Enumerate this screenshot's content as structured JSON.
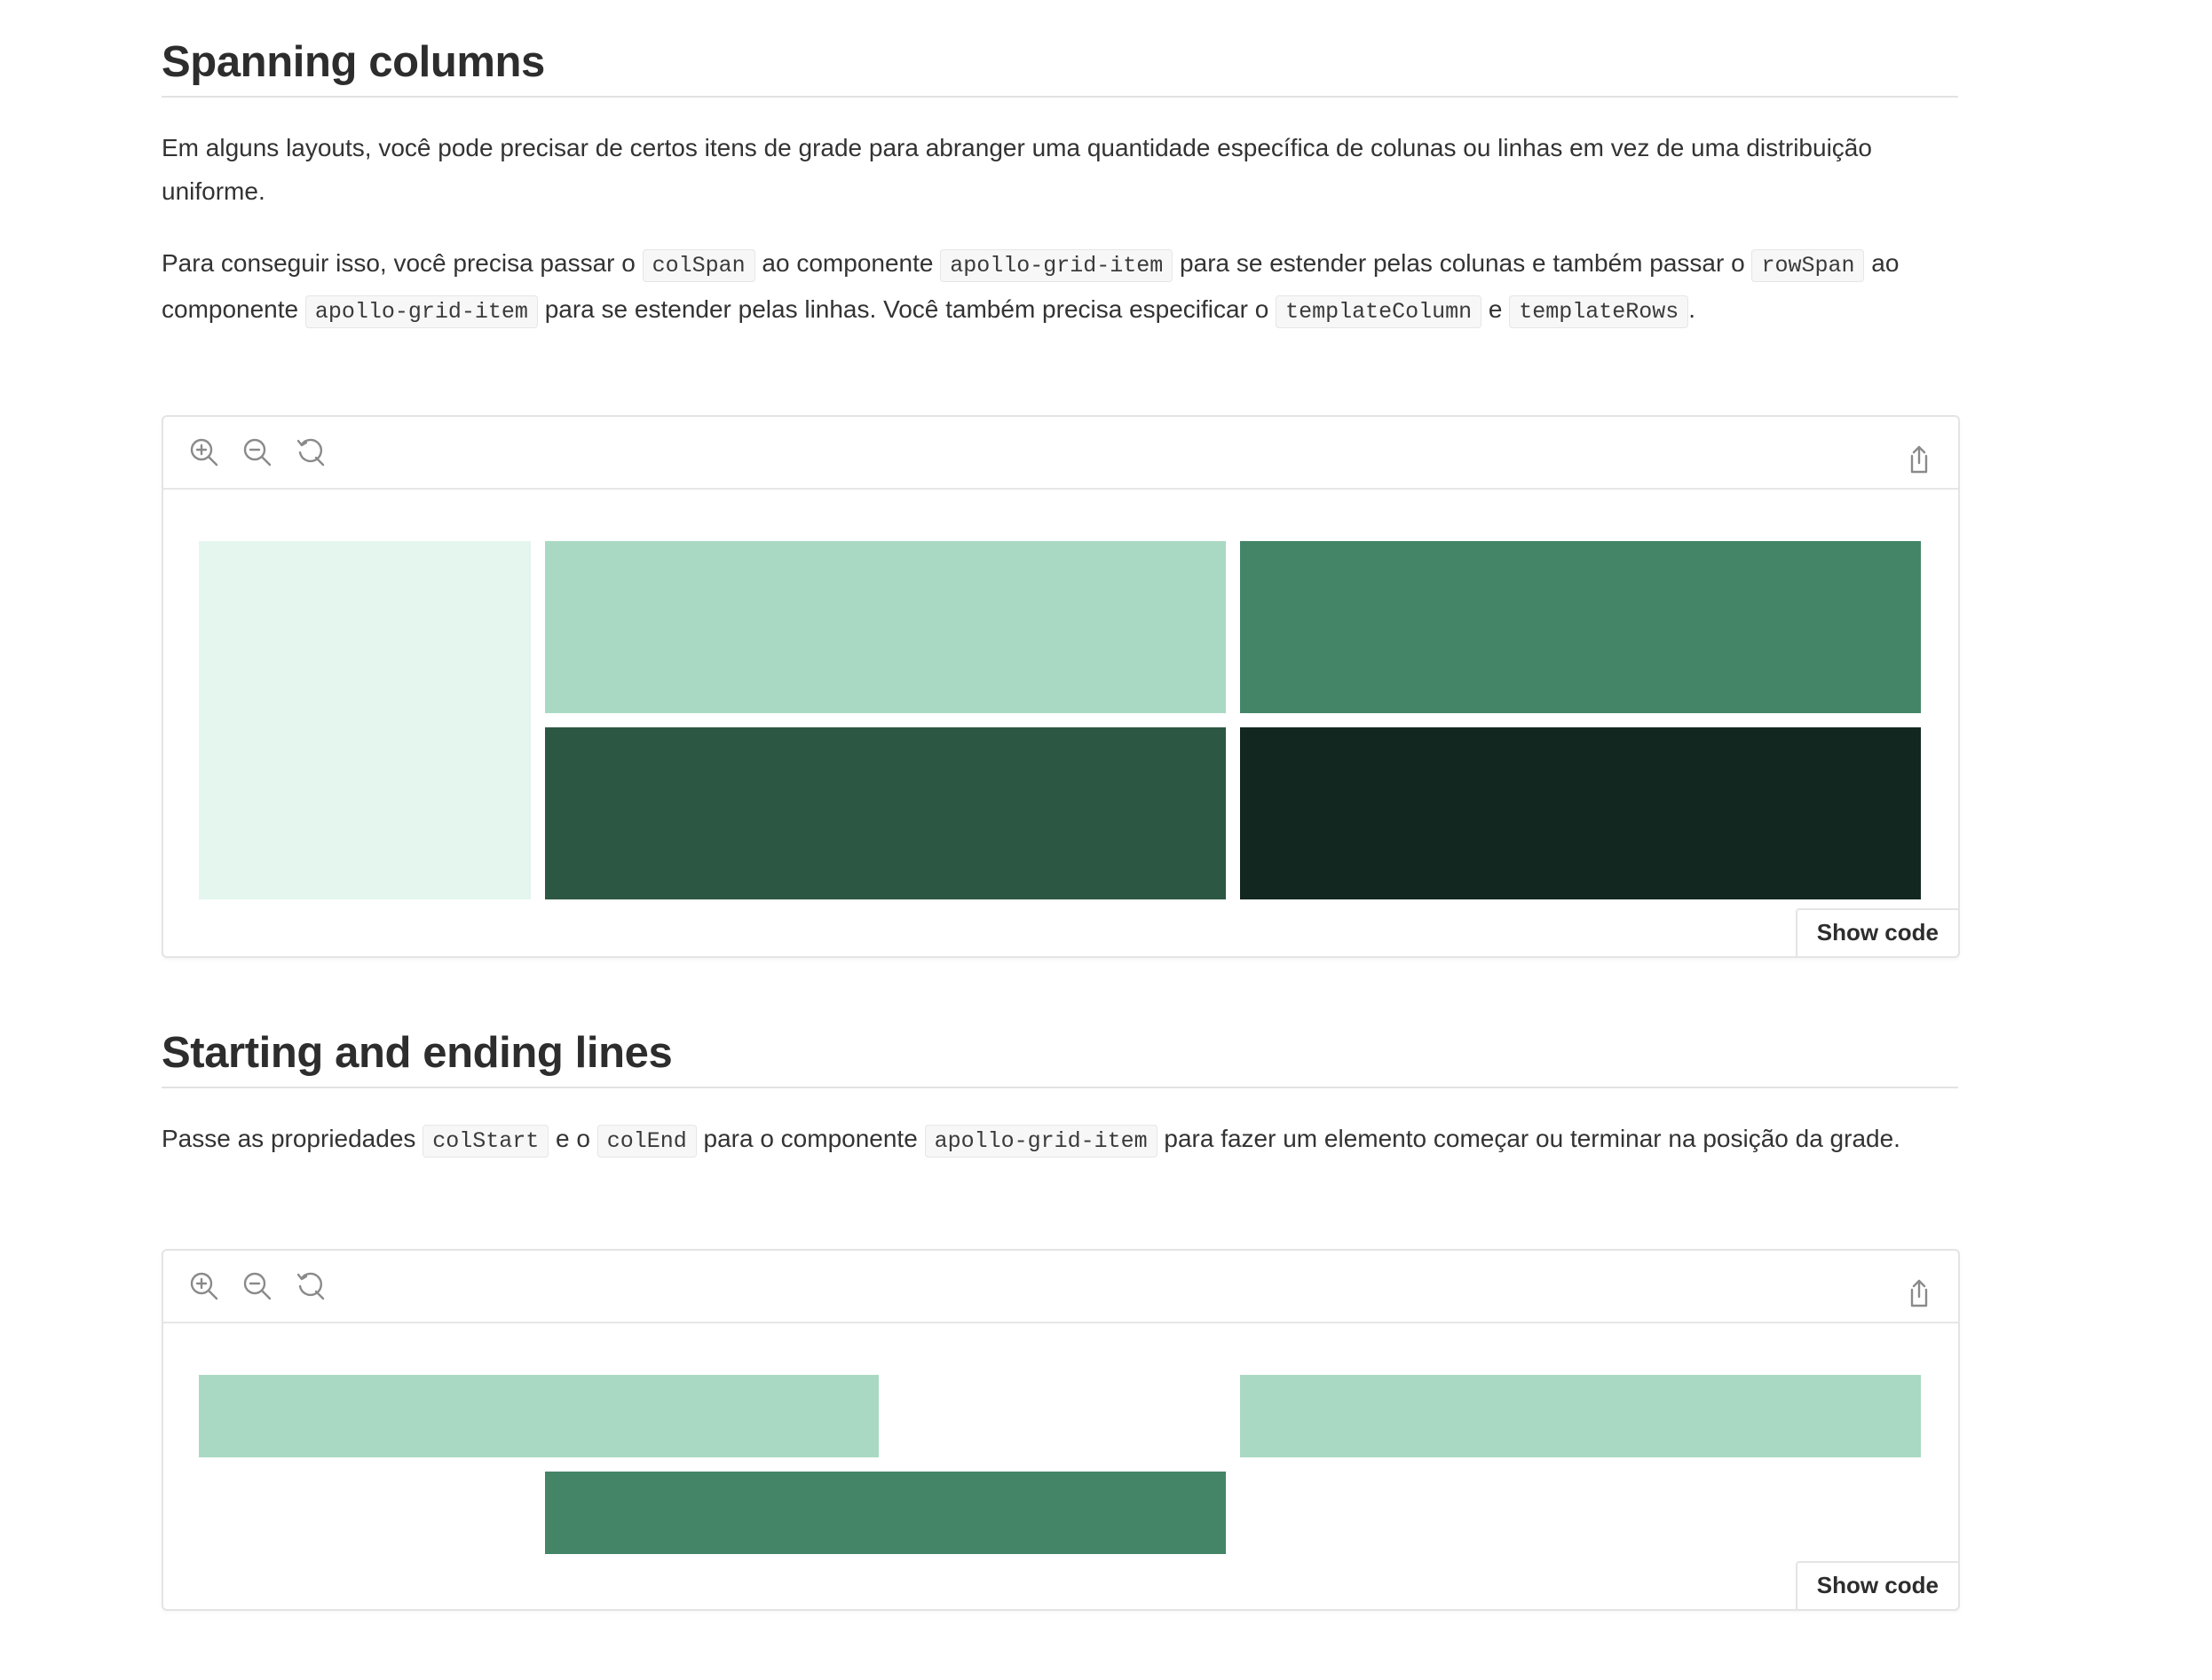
{
  "sections": [
    {
      "heading": "Spanning columns",
      "paragraph1": "Em alguns layouts, você pode precisar de certos itens de grade para abranger uma quantidade específica de colunas ou linhas em vez de uma distribuição uniforme.",
      "paragraph2": {
        "t1": "Para conseguir isso, você precisa passar o ",
        "c1": "colSpan",
        "t2": " ao componente ",
        "c2": "apollo-grid-item",
        "t3": " para se estender pelas colunas e também passar o ",
        "c3": "rowSpan",
        "t4": " ao componente ",
        "c4": "apollo-grid-item",
        "t5": " para se estender pelas linhas. Você também precisa especificar o ",
        "c5": "templateColumn",
        "t6": " e ",
        "c6": "templateRows",
        "t7": "."
      },
      "demo": {
        "show_code_label": "Show code",
        "colors": [
          "#e4f6ee",
          "#aad9c3",
          "#448567",
          "#2c5742",
          "#12271f"
        ]
      }
    },
    {
      "heading": "Starting and ending lines",
      "paragraph": {
        "t1": "Passe as propriedades ",
        "c1": "colStart",
        "t2": " e o ",
        "c2": "colEnd",
        "t3": " para o componente ",
        "c3": "apollo-grid-item",
        "t4": " para fazer um elemento começar ou terminar na posição da grade."
      },
      "demo": {
        "show_code_label": "Show code",
        "colors": [
          "#aad9c3",
          "#aad9c3",
          "#448567"
        ]
      }
    }
  ],
  "toolbar_icons": [
    "zoom-in-icon",
    "zoom-out-icon",
    "reset-icon",
    "share-icon"
  ]
}
